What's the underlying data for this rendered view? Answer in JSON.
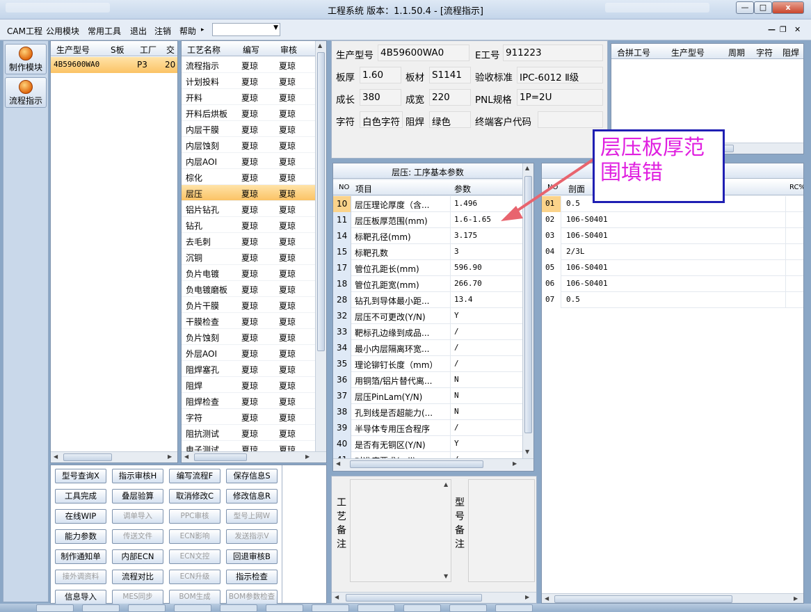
{
  "window": {
    "title": "工程系统  版本：1.1.50.4 - [流程指示]",
    "min_label": "—",
    "max_label": "□",
    "close_label": "x"
  },
  "menu": {
    "items": [
      "CAM工程",
      "公用模块",
      "常用工具",
      "退出",
      "注销",
      "帮助"
    ],
    "help_arrow": "▸",
    "combo_value": "",
    "mdi_min": "—",
    "mdi_restore": "❐",
    "mdi_close": "✕"
  },
  "nav": {
    "make_module": "制作模块",
    "flow_indicator": "流程指示"
  },
  "orders": {
    "headers": [
      "生产型号",
      "S板",
      "工厂",
      "交"
    ],
    "rows": [
      {
        "model": "4B59600WA0",
        "s": "",
        "factory": "P3",
        "due": "20"
      }
    ]
  },
  "process": {
    "headers": [
      "工艺名称",
      "编写",
      "审核"
    ],
    "rows": [
      {
        "name": "流程指示",
        "author": "夏琼",
        "reviewer": "夏琼"
      },
      {
        "name": "计划投料",
        "author": "夏琼",
        "reviewer": "夏琼"
      },
      {
        "name": "开料",
        "author": "夏琼",
        "reviewer": "夏琼"
      },
      {
        "name": "开料后烘板",
        "author": "夏琼",
        "reviewer": "夏琼"
      },
      {
        "name": "内层干膜",
        "author": "夏琼",
        "reviewer": "夏琼"
      },
      {
        "name": "内层蚀刻",
        "author": "夏琼",
        "reviewer": "夏琼"
      },
      {
        "name": "内层AOI",
        "author": "夏琼",
        "reviewer": "夏琼"
      },
      {
        "name": "棕化",
        "author": "夏琼",
        "reviewer": "夏琼"
      },
      {
        "name": "层压",
        "author": "夏琼",
        "reviewer": "夏琼"
      },
      {
        "name": "铝片钻孔",
        "author": "夏琼",
        "reviewer": "夏琼"
      },
      {
        "name": "钻孔",
        "author": "夏琼",
        "reviewer": "夏琼"
      },
      {
        "name": "去毛刺",
        "author": "夏琼",
        "reviewer": "夏琼"
      },
      {
        "name": "沉铜",
        "author": "夏琼",
        "reviewer": "夏琼"
      },
      {
        "name": "负片电镀",
        "author": "夏琼",
        "reviewer": "夏琼"
      },
      {
        "name": "负电镀磨板",
        "author": "夏琼",
        "reviewer": "夏琼"
      },
      {
        "name": "负片干膜",
        "author": "夏琼",
        "reviewer": "夏琼"
      },
      {
        "name": "干膜检查",
        "author": "夏琼",
        "reviewer": "夏琼"
      },
      {
        "name": "负片蚀刻",
        "author": "夏琼",
        "reviewer": "夏琼"
      },
      {
        "name": "外层AOI",
        "author": "夏琼",
        "reviewer": "夏琼"
      },
      {
        "name": "阻焊塞孔",
        "author": "夏琼",
        "reviewer": "夏琼"
      },
      {
        "name": "阻焊",
        "author": "夏琼",
        "reviewer": "夏琼"
      },
      {
        "name": "阻焊检查",
        "author": "夏琼",
        "reviewer": "夏琼"
      },
      {
        "name": "字符",
        "author": "夏琼",
        "reviewer": "夏琼"
      },
      {
        "name": "阻抗测试",
        "author": "夏琼",
        "reviewer": "夏琼"
      },
      {
        "name": "电子测试",
        "author": "夏琼",
        "reviewer": "夏琼"
      }
    ],
    "selected_index": 8
  },
  "actions": [
    {
      "label": "型号查询X",
      "enabled": true
    },
    {
      "label": "指示审核H",
      "enabled": true
    },
    {
      "label": "编写流程F",
      "enabled": true
    },
    {
      "label": "保存信息S",
      "enabled": true
    },
    {
      "label": "工具完成",
      "enabled": true
    },
    {
      "label": "叠层验算",
      "enabled": true
    },
    {
      "label": "取消修改C",
      "enabled": true
    },
    {
      "label": "修改信息R",
      "enabled": true
    },
    {
      "label": "在线WIP",
      "enabled": true
    },
    {
      "label": "调单导入",
      "enabled": false
    },
    {
      "label": "PPC审核",
      "enabled": false
    },
    {
      "label": "型号上网W",
      "enabled": false
    },
    {
      "label": "能力参数",
      "enabled": true
    },
    {
      "label": "传送文件",
      "enabled": false
    },
    {
      "label": "ECN影响",
      "enabled": false
    },
    {
      "label": "发送指示V",
      "enabled": false
    },
    {
      "label": "制作通知单",
      "enabled": true
    },
    {
      "label": "内部ECN",
      "enabled": true
    },
    {
      "label": "ECN文控",
      "enabled": false
    },
    {
      "label": "回退审核B",
      "enabled": true
    },
    {
      "label": "接外调资料",
      "enabled": false
    },
    {
      "label": "流程对比",
      "enabled": true
    },
    {
      "label": "ECN升级",
      "enabled": false
    },
    {
      "label": "指示检查",
      "enabled": true
    },
    {
      "label": "信息导入",
      "enabled": true
    },
    {
      "label": "MES同步",
      "enabled": false
    },
    {
      "label": "BOM生成",
      "enabled": false
    },
    {
      "label": "BOM参数检查",
      "enabled": false
    }
  ],
  "info": {
    "model_label": "生产型号",
    "model_value": "4B59600WA0",
    "e_label": "E工号",
    "e_value": "911223",
    "thick_label": "板厚",
    "thick_value": "1.60",
    "material_label": "板材",
    "material_value": "S1141",
    "std_label": "验收标准",
    "std_value": "IPC-6012 Ⅱ级",
    "length_label": "成长",
    "length_value": "380",
    "width_label": "成宽",
    "width_value": "220",
    "pnl_label": "PNL规格",
    "pnl_value": "1P=2U",
    "char_label": "字符",
    "char_value": "白色字符",
    "mask_label": "阻焊",
    "mask_value": "绿色",
    "cust_label": "终端客户代码",
    "cust_value": ""
  },
  "merge": {
    "headers": [
      "合拼工号",
      "生产型号",
      "周期",
      "字符",
      "阻焊"
    ]
  },
  "params": {
    "title": "层压: 工序基本参数",
    "headers": [
      "NO",
      "项目",
      "参数"
    ],
    "rows": [
      {
        "no": "10",
        "item": "层压理论厚度（含...",
        "value": "1.496"
      },
      {
        "no": "11",
        "item": "层压板厚范围(mm)",
        "value": "1.6-1.65"
      },
      {
        "no": "14",
        "item": "标靶孔径(mm)",
        "value": "3.175"
      },
      {
        "no": "15",
        "item": "标靶孔数",
        "value": "3"
      },
      {
        "no": "17",
        "item": "管位孔距长(mm)",
        "value": "596.90"
      },
      {
        "no": "18",
        "item": "管位孔距宽(mm)",
        "value": "266.70"
      },
      {
        "no": "28",
        "item": "钻孔到导体最小距...",
        "value": "13.4"
      },
      {
        "no": "32",
        "item": "层压不可更改(Y/N)",
        "value": "Y"
      },
      {
        "no": "33",
        "item": "靶标孔边缘到成品...",
        "value": "/"
      },
      {
        "no": "34",
        "item": "最小内层隔离环宽...",
        "value": "/"
      },
      {
        "no": "35",
        "item": "理论铆钉长度（mm）",
        "value": "/"
      },
      {
        "no": "36",
        "item": "用铜箔/铝片替代离...",
        "value": "N"
      },
      {
        "no": "37",
        "item": "层压PinLam(Y/N)",
        "value": "N"
      },
      {
        "no": "38",
        "item": "孔到线是否超能力(...",
        "value": "N"
      },
      {
        "no": "39",
        "item": "半导体专用压合程序",
        "value": "/"
      },
      {
        "no": "40",
        "item": "是否有无铜区(Y/N)",
        "value": "Y"
      },
      {
        "no": "41",
        "item": "对准度要求(mil)",
        "value": "/"
      }
    ]
  },
  "stack": {
    "headers": [
      "NO",
      "剖面",
      "RC%"
    ],
    "rows": [
      {
        "no": "01",
        "profile": "0.5"
      },
      {
        "no": "02",
        "profile": "106-S0401"
      },
      {
        "no": "03",
        "profile": "106-S0401"
      },
      {
        "no": "04",
        "profile": "2/3L"
      },
      {
        "no": "05",
        "profile": "106-S0401"
      },
      {
        "no": "06",
        "profile": "106-S0401"
      },
      {
        "no": "07",
        "profile": "0.5"
      }
    ]
  },
  "memo": {
    "process_note": [
      "工",
      "艺",
      "备",
      "注"
    ],
    "model_note": [
      "型",
      "号",
      "备",
      "注"
    ]
  },
  "annotation": {
    "text": "层压板厚范围填错",
    "color": "#e020e0",
    "border_color": "#1f1fb3",
    "arrow_color": "#e8646e"
  },
  "colors": {
    "selection": "#fbc365",
    "panel_border": "#7f93ad"
  }
}
